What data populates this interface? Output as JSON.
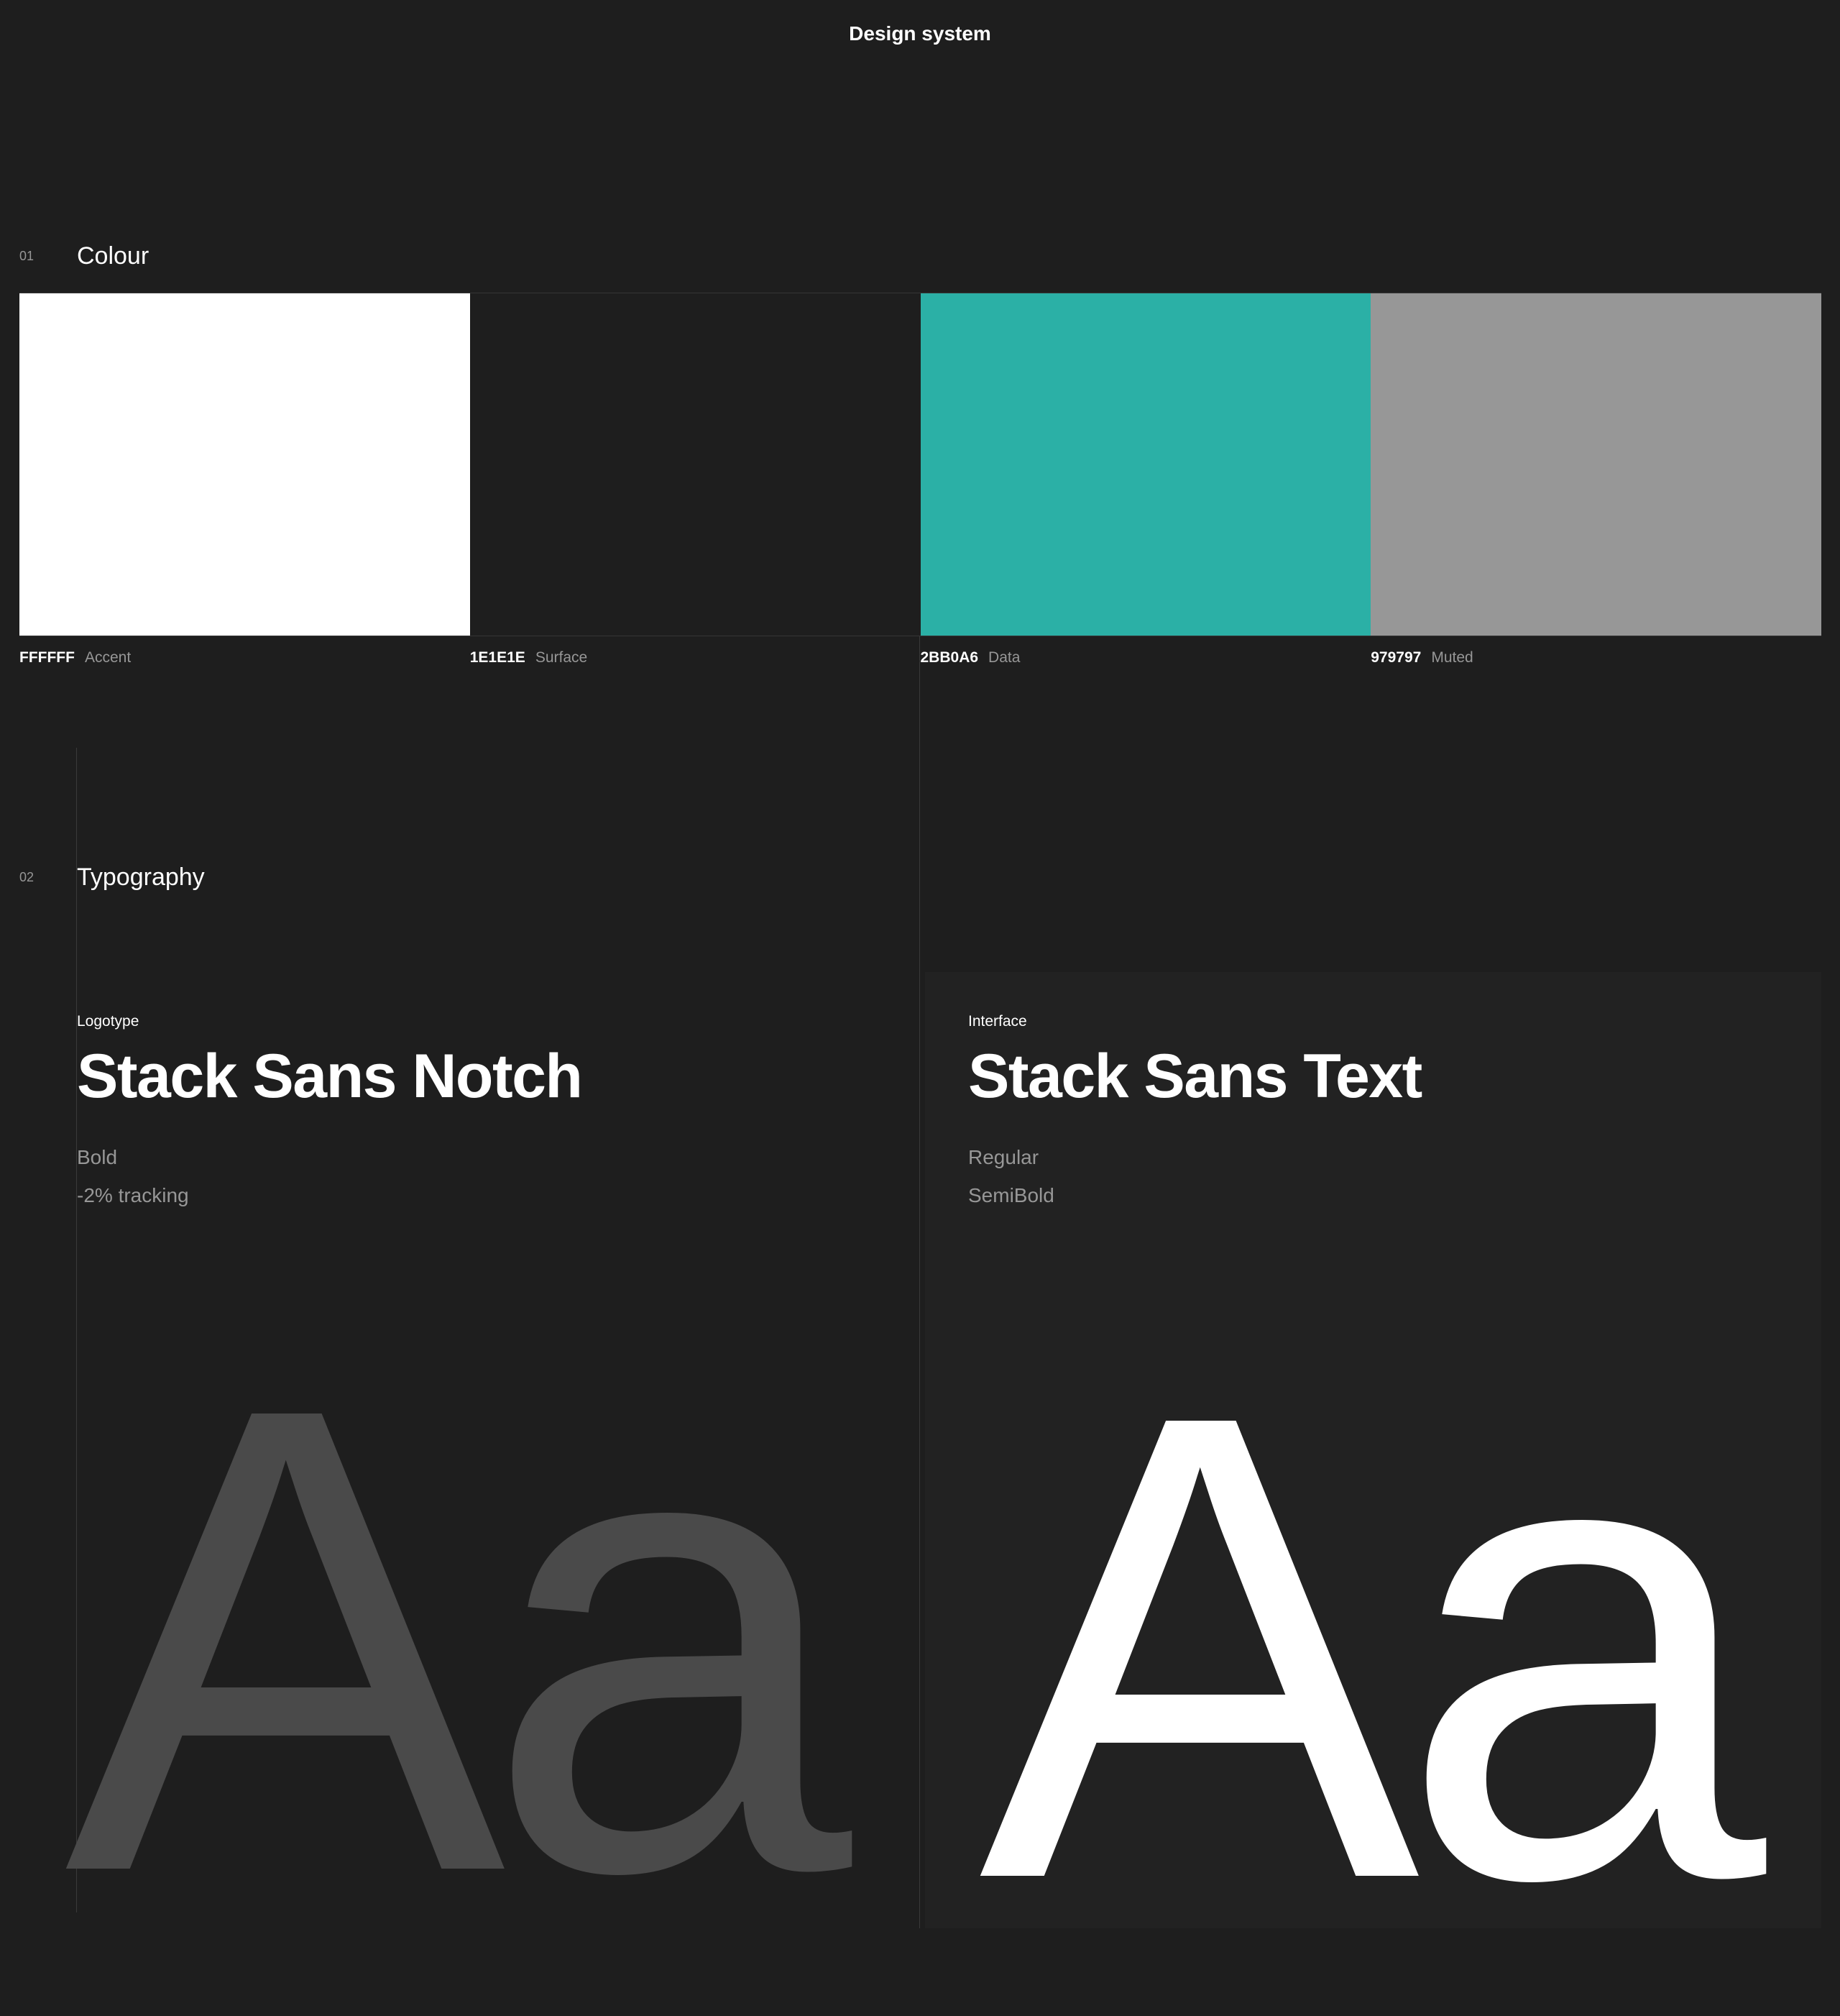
{
  "header": {
    "title": "Design system"
  },
  "colour": {
    "number": "01",
    "title": "Colour",
    "swatches": [
      {
        "hex": "FFFFFF",
        "name": "Accent",
        "color": "#FFFFFF"
      },
      {
        "hex": "1E1E1E",
        "name": "Surface",
        "color": "#1E1E1E"
      },
      {
        "hex": "2BB0A6",
        "name": "Data",
        "color": "#2BB0A6"
      },
      {
        "hex": "979797",
        "name": "Muted",
        "color": "#979797"
      }
    ]
  },
  "typography": {
    "number": "02",
    "title": "Typography",
    "logotype": {
      "label": "Logotype",
      "font_name": "Stack Sans Notch",
      "specs": [
        "Bold",
        "-2% tracking"
      ],
      "sample": "Aa",
      "sample_color": "#4A4A4A"
    },
    "interface": {
      "label": "Interface",
      "font_name": "Stack Sans Text",
      "specs": [
        "Regular",
        "SemiBold"
      ],
      "sample": "Aa",
      "sample_color": "#FFFFFF"
    }
  }
}
